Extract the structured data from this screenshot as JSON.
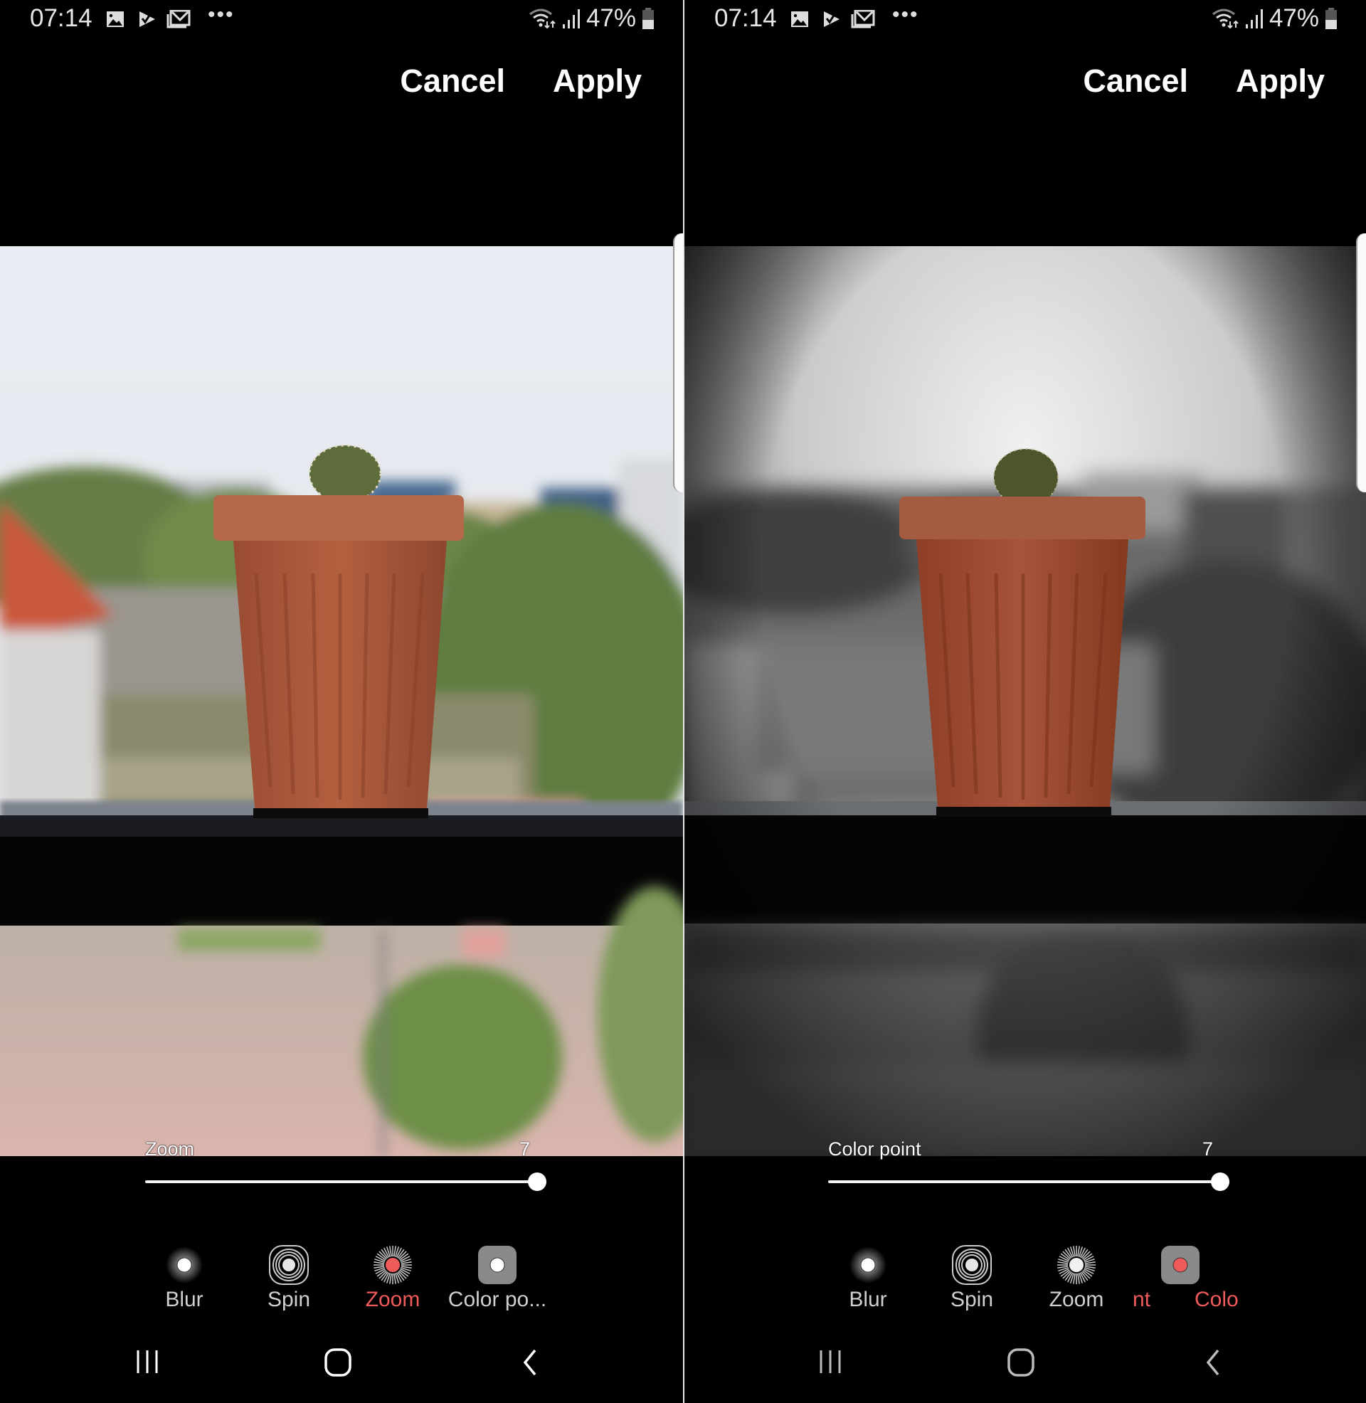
{
  "panels": [
    {
      "id": "left",
      "status_bar": {
        "time": "07:14",
        "notification_icons": [
          "gallery-icon",
          "check-task-icon",
          "gmail-icon"
        ],
        "overflow": "•••",
        "battery_percent": "47%",
        "battery_level": 0.47
      },
      "toolbar": {
        "cancel_label": "Cancel",
        "apply_label": "Apply"
      },
      "photo": {
        "description": "Potted cactus on balcony railing with zoom-blurred background"
      },
      "slider": {
        "label": "Zoom",
        "value": "7",
        "fraction": 1.0
      },
      "effects": [
        {
          "label": "Blur",
          "icon": "blur-icon",
          "active": false
        },
        {
          "label": "Spin",
          "icon": "spin-icon",
          "active": false
        },
        {
          "label": "Zoom",
          "icon": "zoom-icon",
          "active": true
        },
        {
          "label": "Color po...",
          "icon": "color-point-icon",
          "active": false
        }
      ],
      "nav": [
        "recents-icon",
        "home-icon",
        "back-icon"
      ]
    },
    {
      "id": "right",
      "status_bar": {
        "time": "07:14",
        "notification_icons": [
          "gallery-icon",
          "check-task-icon",
          "gmail-icon"
        ],
        "overflow": "•••",
        "battery_percent": "47%",
        "battery_level": 0.47
      },
      "toolbar": {
        "cancel_label": "Cancel",
        "apply_label": "Apply"
      },
      "photo": {
        "description": "Color point effect: pot in color, grayscale blurred vignetted background"
      },
      "slider": {
        "label": "Color point",
        "value": "7",
        "fraction": 1.0
      },
      "effects": [
        {
          "label": "Blur",
          "icon": "blur-icon",
          "active": false
        },
        {
          "label": "Spin",
          "icon": "spin-icon",
          "active": false
        },
        {
          "label": "Zoom",
          "icon": "zoom-icon",
          "active": false
        },
        {
          "label": "Color point",
          "icon": "color-point-icon",
          "active": true
        }
      ],
      "marquee_text": {
        "part1": "nt",
        "part2": "Colo"
      },
      "nav": [
        "recents-icon",
        "home-icon",
        "back-icon"
      ]
    }
  ],
  "colors": {
    "accent_active": "#ef5a5a",
    "label_inactive": "#cfcfcf",
    "background": "#000000",
    "pot": "#a85a3c"
  }
}
